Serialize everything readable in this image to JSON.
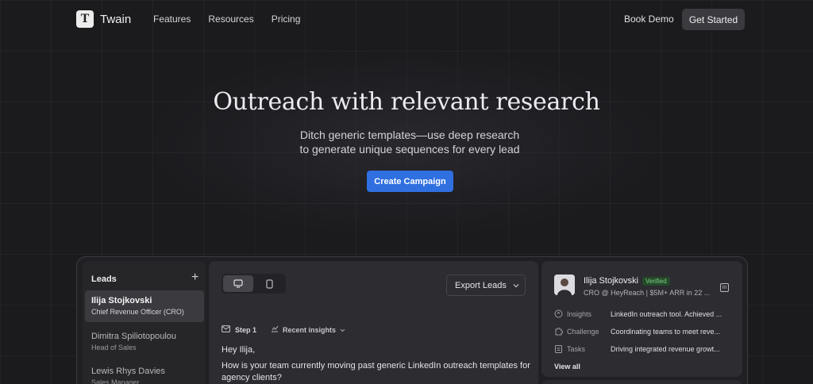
{
  "nav": {
    "brand": "Twain",
    "logo_letter": "T",
    "links": [
      "Features",
      "Resources",
      "Pricing"
    ],
    "book_demo": "Book Demo",
    "get_started": "Get Started"
  },
  "hero": {
    "title": "Outreach with relevant research",
    "subtitle_line1": "Ditch generic templates—use deep research",
    "subtitle_line2": "to generate unique sequences for every lead",
    "cta": "Create Campaign"
  },
  "leads": {
    "title": "Leads",
    "add_icon": "plus-icon",
    "items": [
      {
        "name": "Ilija Stojkovski",
        "role": "Chief Revenue Officer (CRO)",
        "active": true
      },
      {
        "name": "Dimitra Spiliotopoulou",
        "role": "Head of Sales",
        "active": false
      },
      {
        "name": "Lewis Rhys Davies",
        "role": "Sales Manager",
        "active": false
      }
    ]
  },
  "composer": {
    "view_toggle": [
      "desktop-icon",
      "mobile-icon"
    ],
    "export_label": "Export Leads",
    "step_label": "Step 1",
    "insights_label": "Recent insights",
    "message": {
      "greeting": "Hey Ilija,",
      "body": "How is your team currently moving past generic LinkedIn outreach templates for agency clients?"
    }
  },
  "profile": {
    "name": "Ilija Stojkovski",
    "badge": "Verified",
    "tagline": "CRO @ HeyReach | $5M+ ARR in 22 ...",
    "rows": [
      {
        "icon": "lightbulb-icon",
        "label": "Insights",
        "value": "LinkedIn outreach tool. Achieved ..."
      },
      {
        "icon": "puzzle-icon",
        "label": "Challenge",
        "value": "Coordinating teams to meet reve..."
      },
      {
        "icon": "clipboard-icon",
        "label": "Tasks",
        "value": "Driving integrated revenue growt..."
      }
    ],
    "view_all": "View all",
    "accent_verified": "#7fcf84"
  },
  "colors": {
    "background": "#1b1b1e",
    "primary_button": "#2f6fe0"
  }
}
